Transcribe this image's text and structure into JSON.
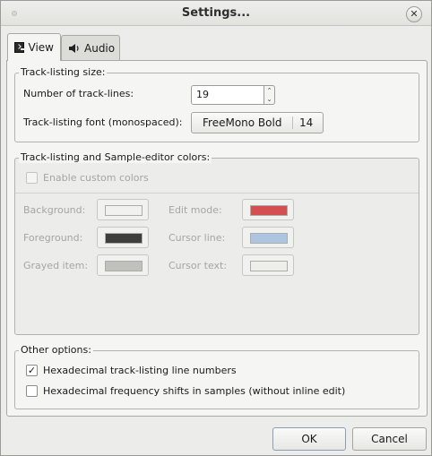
{
  "window": {
    "title": "Settings..."
  },
  "tabs": [
    {
      "label": "View",
      "icon": "terminal-icon",
      "selected": true
    },
    {
      "label": "Audio",
      "icon": "speaker-icon",
      "selected": false
    }
  ],
  "track_listing_size": {
    "title": "Track-listing size:",
    "lines_label": "Number of track-lines:",
    "lines_value": "19",
    "font_label": "Track-listing font (monospaced):",
    "font_name": "FreeMono Bold",
    "font_size": "14"
  },
  "colors": {
    "title": "Track-listing and Sample-editor colors:",
    "enable_label": "Enable custom colors",
    "enable_checked": false,
    "items": [
      {
        "label": "Background:",
        "color": "#f2f2ef"
      },
      {
        "label": "Foreground:",
        "color": "#1f1f1f"
      },
      {
        "label": "Grayed item:",
        "color": "#b8b8b4"
      },
      {
        "label": "Edit mode:",
        "color": "#cf3535"
      },
      {
        "label": "Cursor line:",
        "color": "#a3bedf"
      },
      {
        "label": "Cursor text:",
        "color": "#eeeeea"
      }
    ]
  },
  "other": {
    "title": "Other options:",
    "hex_lines_label": "Hexadecimal track-listing line numbers",
    "hex_lines_checked": true,
    "hex_freq_label": "Hexadecimal frequency shifts in samples (without inline edit)",
    "hex_freq_checked": false
  },
  "footer": {
    "ok_label": "OK",
    "cancel_label": "Cancel"
  }
}
